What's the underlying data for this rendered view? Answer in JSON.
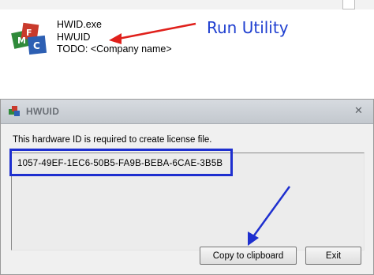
{
  "explorer": {
    "file_name": "HWID.exe",
    "product_name": "HWUID",
    "company_line": "TODO: <Company name>",
    "icon": "mfc-app-icon"
  },
  "annotations": {
    "run_label": "Run Utility",
    "color": "#1f3fd0",
    "arrow_color_red": "#e0201b",
    "arrow_color_blue": "#1e2fcf"
  },
  "dialog": {
    "title": "HWUID",
    "title_icon": "app-icon",
    "close_icon": "close-icon",
    "message": "This hardware ID is required to create license file.",
    "hardware_id": "1057-49EF-1EC6-50B5-FA9B-BEBA-6CAE-3B5B",
    "buttons": {
      "copy": "Copy to clipboard",
      "exit": "Exit"
    }
  }
}
